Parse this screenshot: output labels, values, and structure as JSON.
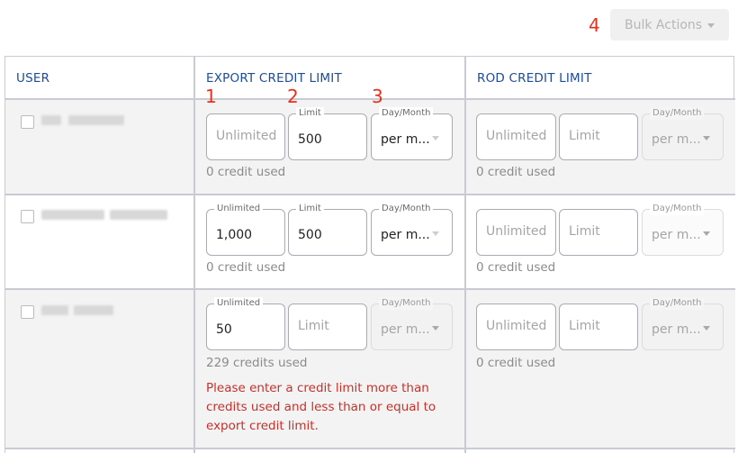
{
  "markers": [
    "1",
    "2",
    "3",
    "4"
  ],
  "toolbar": {
    "bulk_actions_label": "Bulk Actions"
  },
  "columns": {
    "user": "USER",
    "export": "EXPORT CREDIT LIMIT",
    "rod": "ROD CREDIT LIMIT"
  },
  "labels": {
    "unlimited": "Unlimited",
    "limit": "Limit",
    "period": "Day/Month"
  },
  "rows": [
    {
      "export": {
        "unlimited_value": "",
        "limit_value": "500",
        "period_value": "per m...",
        "credits_used": "0 credit used"
      },
      "rod": {
        "unlimited_value": "",
        "limit_value": "",
        "period_value": "per m...",
        "credits_used": "0 credit used"
      }
    },
    {
      "export": {
        "unlimited_value": "1,000",
        "limit_value": "500",
        "period_value": "per m...",
        "credits_used": "0 credit used"
      },
      "rod": {
        "unlimited_value": "",
        "limit_value": "",
        "period_value": "per m...",
        "credits_used": "0 credit used"
      }
    },
    {
      "export": {
        "unlimited_value": "50",
        "limit_value": "",
        "period_value": "per m...",
        "credits_used": "229 credits used",
        "error": "Please enter a credit limit more than credits used and less than or equal to export credit limit."
      },
      "rod": {
        "unlimited_value": "",
        "limit_value": "",
        "period_value": "per m...",
        "credits_used": "0 credit used"
      }
    }
  ],
  "colors": {
    "header_text": "#1d4c9a",
    "marker": "#e8301c",
    "error": "#c4312a",
    "row_alt_bg": "#f3f3f4"
  }
}
